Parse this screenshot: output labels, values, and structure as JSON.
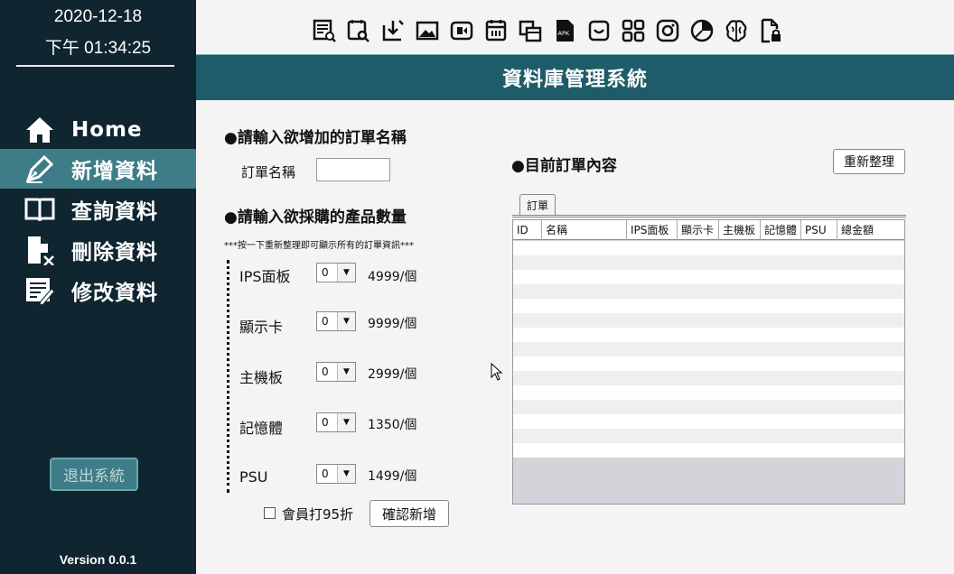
{
  "sidebar": {
    "date": "2020-12-18",
    "time": "下午 01:34:25",
    "items": [
      {
        "label": "Home",
        "icon": "home-icon"
      },
      {
        "label": "新增資料",
        "icon": "pen-icon"
      },
      {
        "label": "查詢資料",
        "icon": "book-icon"
      },
      {
        "label": "刪除資料",
        "icon": "delete-file-icon"
      },
      {
        "label": "修改資料",
        "icon": "edit-list-icon"
      }
    ],
    "logout_label": "退出系統",
    "version": "Version 0.0.1"
  },
  "toolbar": {
    "icons": [
      "report-icon",
      "search-file-icon",
      "download-icon",
      "image-icon",
      "video-icon",
      "calendar-icon",
      "copy-icon",
      "apk-icon",
      "inbox-icon",
      "grid-icon",
      "instagram-icon",
      "pie-chart-icon",
      "brain-icon",
      "file-lock-icon"
    ]
  },
  "header": {
    "title": "資料庫管理系統"
  },
  "form": {
    "order_section_title": "●請輸入欲增加的訂單名稱",
    "order_name_label": "訂單名稱",
    "order_name_value": "",
    "qty_section_title": "●請輸入欲採購的產品數量",
    "note": "***按一下重新整理即可顯示所有的訂單資訊***",
    "products": [
      {
        "name": "IPS面板",
        "qty": "0",
        "price": "4999/個"
      },
      {
        "name": "顯示卡",
        "qty": "0",
        "price": "9999/個"
      },
      {
        "name": "主機板",
        "qty": "0",
        "price": "2999/個"
      },
      {
        "name": "記憶體",
        "qty": "0",
        "price": "1350/個"
      },
      {
        "name": "PSU",
        "qty": "0",
        "price": "1499/個"
      }
    ],
    "member_discount_label": "會員打95折",
    "member_discount_checked": false,
    "confirm_label": "確認新增"
  },
  "orders": {
    "section_title": "●目前訂單內容",
    "refresh_label": "重新整理",
    "tab_label": "訂單",
    "columns": [
      "ID",
      "名稱",
      "IPS面板",
      "顯示卡",
      "主機板",
      "記憶體",
      "PSU",
      "總金額"
    ],
    "rows": []
  },
  "colors": {
    "sidebar_bg": "#0f2530",
    "active_item": "#3e7d87",
    "header_bg": "#1f5c6a"
  }
}
